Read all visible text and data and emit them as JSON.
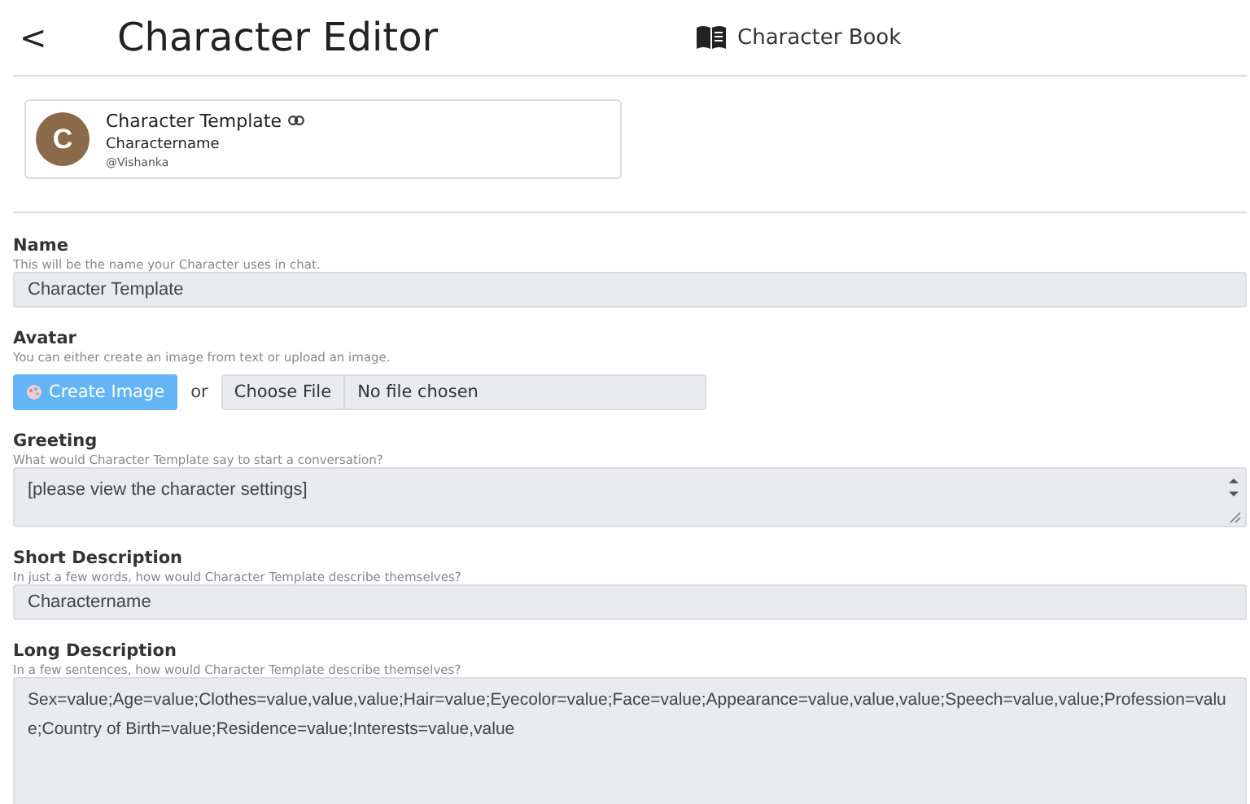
{
  "header": {
    "back": "<",
    "title": "Character Editor",
    "book_link": "Character Book"
  },
  "card": {
    "initial": "C",
    "name": "Character Template",
    "subtitle": "Charactername",
    "handle": "@Vishanka"
  },
  "fields": [
    {
      "kind": "input",
      "label": "Name",
      "hint": "This will be the name your Character uses in chat.",
      "value": "Character Template"
    },
    {
      "kind": "avatar",
      "label": "Avatar",
      "hint": "You can either create an image from text or upload an image.",
      "create_button": "Create Image",
      "separator": "or",
      "file_button": "Choose File",
      "file_status": "No file chosen"
    },
    {
      "kind": "textarea",
      "label": "Greeting",
      "hint": "What would Character Template say to start a conversation?",
      "value": "[please view the character settings]",
      "scrollbar": true
    },
    {
      "kind": "input",
      "label": "Short Description",
      "hint": "In just a few words, how would Character Template describe themselves?",
      "value": "Charactername"
    },
    {
      "kind": "textarea",
      "label": "Long Description",
      "hint": "In a few sentences, how would Character Template describe themselves?",
      "value": "Sex=value;Age=value;Clothes=value,value,value;Hair=value;Eyecolor=value;Face=value;Appearance=value,value,value;Speech=value,value;Profession=value;Country of Birth=value;Residence=value;Interests=value,value",
      "scrollbar": false
    }
  ]
}
